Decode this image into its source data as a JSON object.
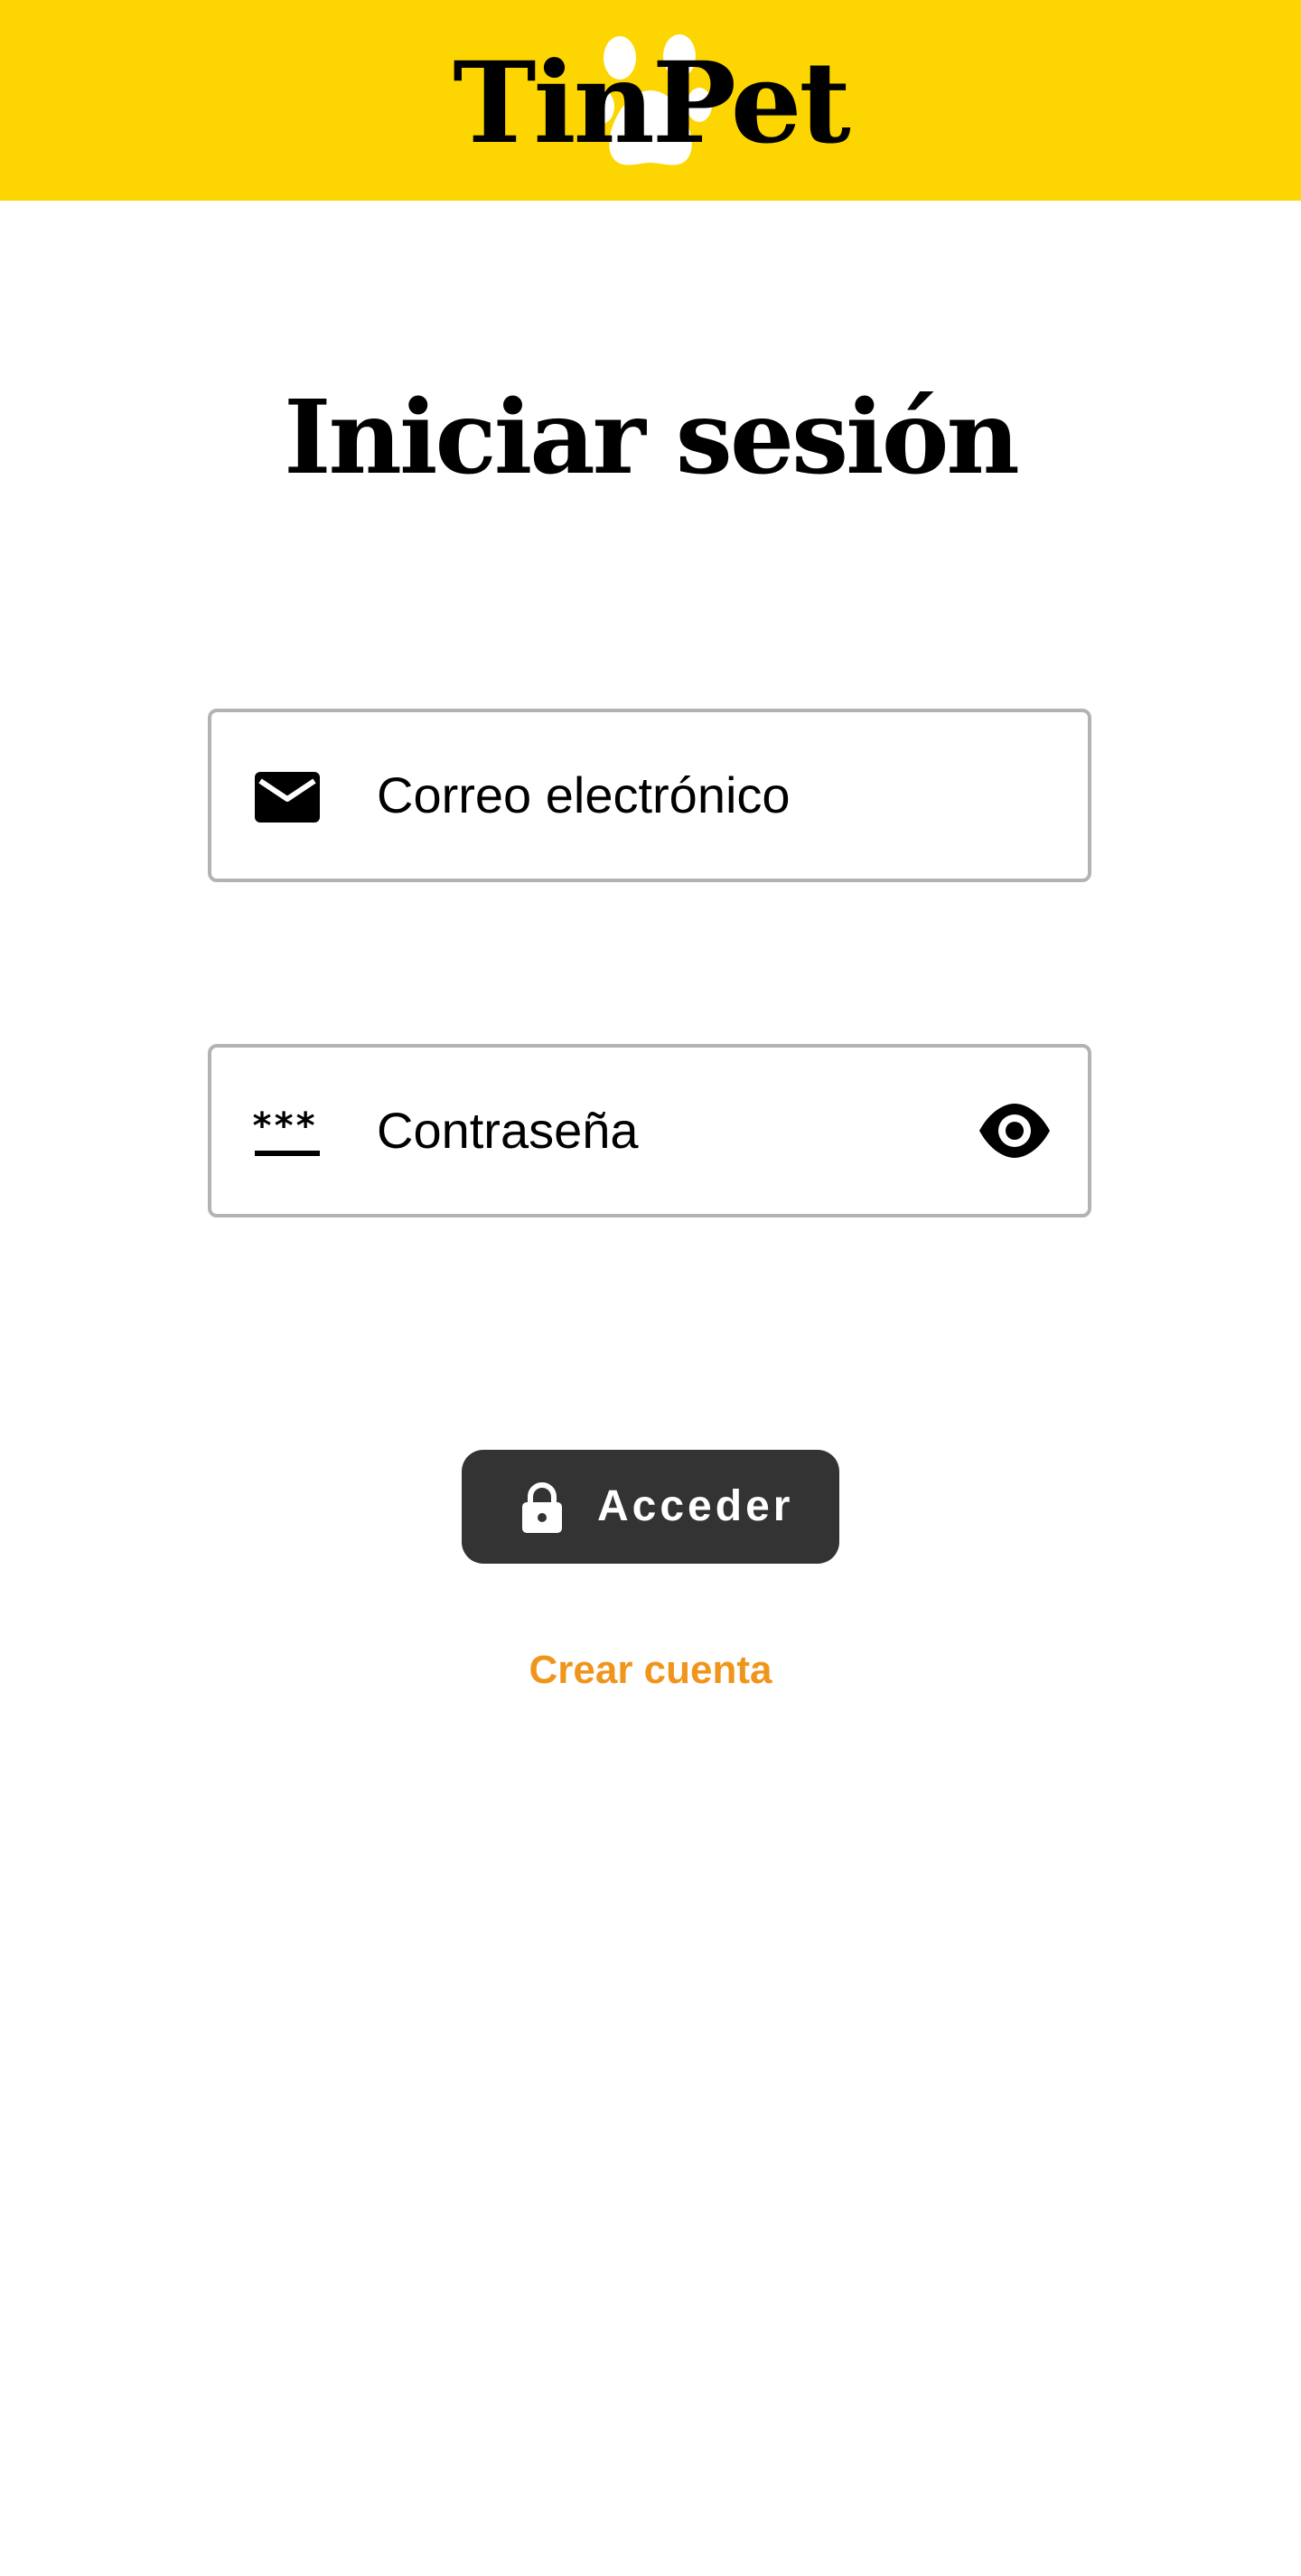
{
  "app": {
    "name": "TinPet",
    "logo_icon": "paw-icon"
  },
  "page": {
    "title": "Iniciar sesión"
  },
  "form": {
    "email": {
      "placeholder": "Correo electrónico",
      "icon": "mail-icon"
    },
    "password": {
      "placeholder": "Contraseña",
      "icon": "password-icon",
      "toggle_icon": "eye-icon"
    },
    "submit": {
      "label": "Acceder",
      "icon": "lock-icon"
    },
    "create_account": {
      "label": "Crear cuenta"
    }
  },
  "colors": {
    "header_bg": "#FDD500",
    "button_bg": "#333333",
    "link": "#F0951C",
    "field_border": "#b3b3b3"
  }
}
